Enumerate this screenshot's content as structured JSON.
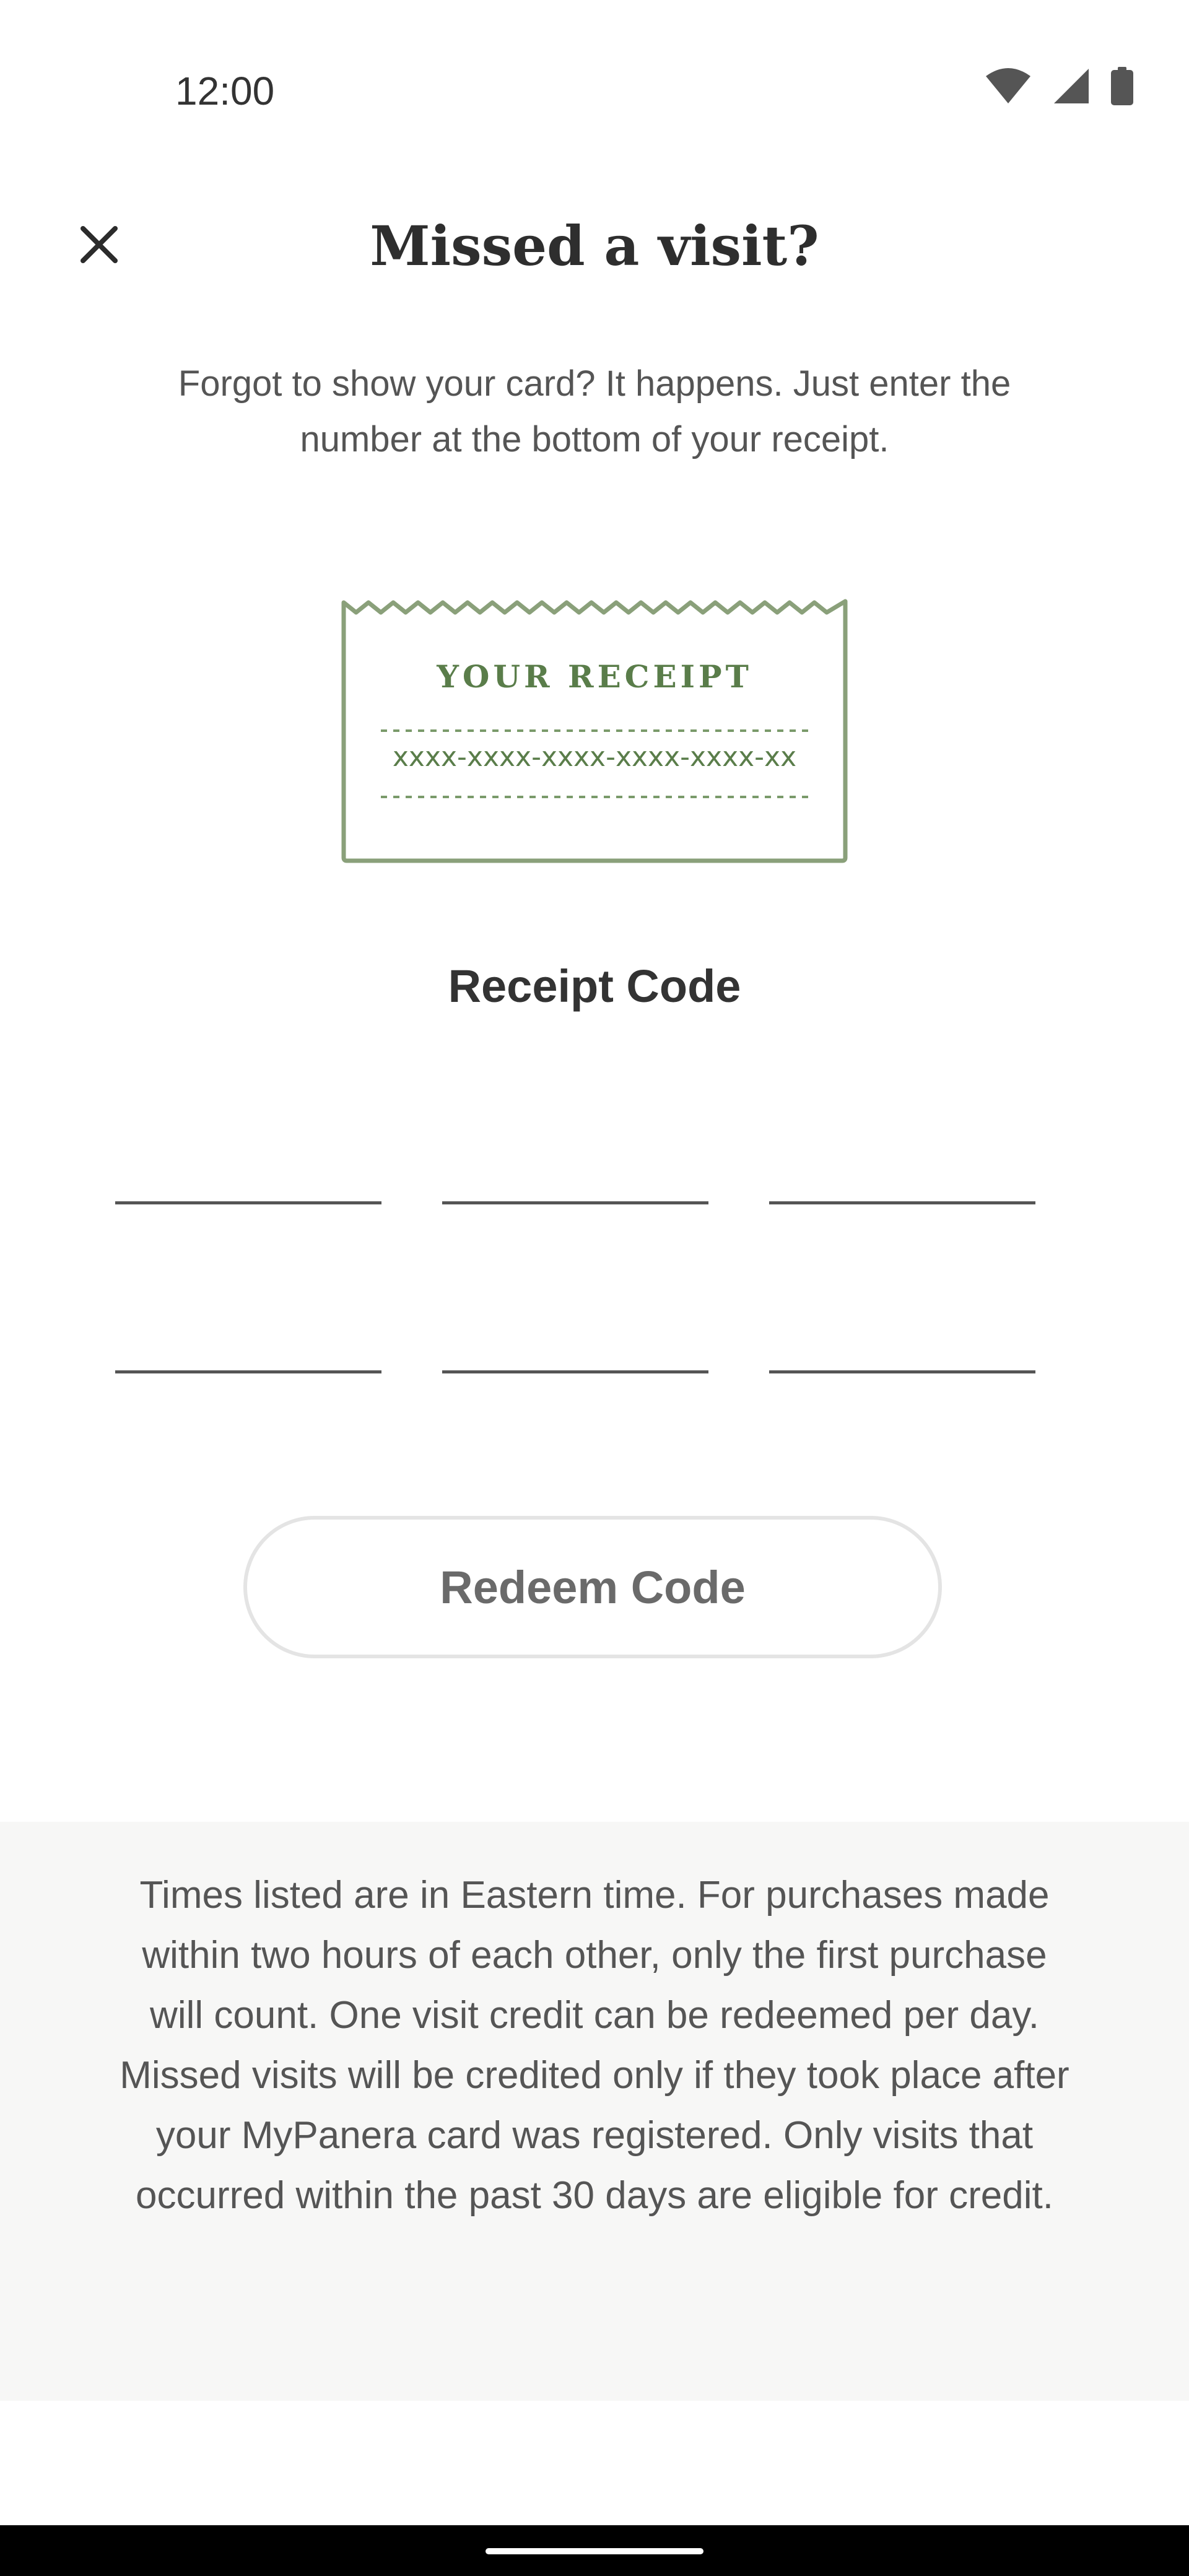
{
  "status_bar": {
    "time": "12:00",
    "icons": [
      "wifi-icon",
      "cellular-signal-icon",
      "battery-icon"
    ]
  },
  "header": {
    "close_icon": "close-icon",
    "title": "Missed a visit?"
  },
  "intro_text": "Forgot to show your card? It happens. Just enter the number at the bottom of your receipt.",
  "receipt_illustration": {
    "title": "YOUR RECEIPT",
    "code_mask": "xxxx-xxxx-xxxx-xxxx-xxxx-xx"
  },
  "receipt_code": {
    "label": "Receipt Code",
    "fields": [
      "",
      "",
      "",
      "",
      "",
      ""
    ]
  },
  "redeem_button": {
    "label": "Redeem Code"
  },
  "disclaimer": {
    "text": "Times listed are in Eastern time. For purchases made within two hours of each other, only the first purchase will count. One visit credit can be redeemed per day. Missed visits will be credited only if they took place after your MyPanera card was registered. Only visits that occurred within the past 30 days are eligible for credit."
  },
  "colors": {
    "accent_green": "#5a7d4a",
    "receipt_border": "#8aa07a",
    "disclaimer_bg": "#f7f7f6",
    "button_border": "#e4e4e4"
  }
}
